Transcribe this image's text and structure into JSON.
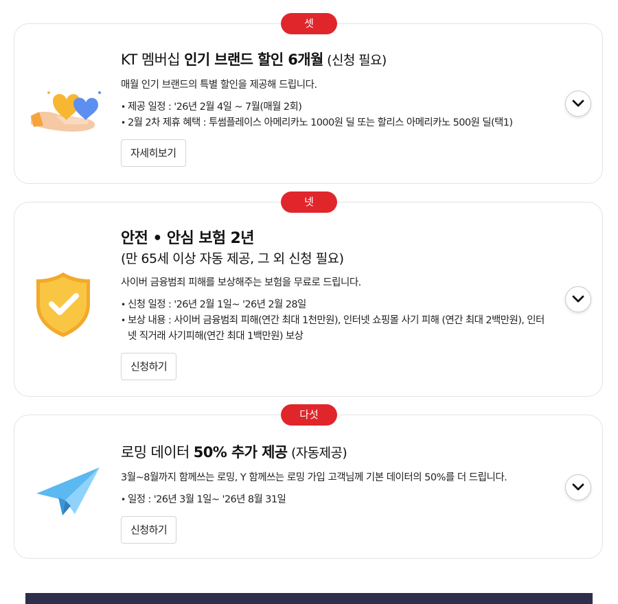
{
  "benefits": [
    {
      "badge": "셋",
      "title_pre": "KT 멤버십 ",
      "title_bold": "인기 브랜드 할인 6개월",
      "title_post": " (신청 필요)",
      "description": "매월 인기 브랜드의 특별 할인을 제공해 드립니다.",
      "bullets": [
        "제공 일정 : '26년 2월 4일 ~ 7월(매월 2회)",
        "2월 2차 제휴 혜택 : 투썸플레이스 아메리카노 1000원 딜 또는 할리스 아메리카노 500원 딜(택1)"
      ],
      "button_label": "자세히보기",
      "illustration": "hand-with-hearts-icon"
    },
    {
      "badge": "넷",
      "title_bold": "안전 • 안심 보험 2년",
      "title_sub": "(만 65세 이상 자동 제공, 그 외 신청 필요)",
      "description": "사이버 금융범죄 피해를 보상해주는 보험을 무료로 드립니다.",
      "bullets": [
        "신청 일정 : '26년 2월 1일~ '26년 2월 28일",
        "보상 내용 : 사이버 금융범죄 피해(연간 최대 1천만원), 인터넷 쇼핑몰 사기 피해 (연간 최대 2백만원), 인터넷 직거래 사기피해(연간 최대 1백만원) 보상"
      ],
      "button_label": "신청하기",
      "illustration": "shield-check-icon"
    },
    {
      "badge": "다섯",
      "title_pre": "로밍 데이터 ",
      "title_bold": "50% 추가 제공",
      "title_post": " (자동제공)",
      "description": "3월~8월까지 함께쓰는 로밍, Y 함께쓰는 로밍 가입 고객님께 기본 데이터의 50%를 더 드립니다.",
      "bullets": [
        "일정 : '26년 3월 1일~ '26년 8월 31일"
      ],
      "button_label": "신청하기",
      "illustration": "paper-plane-icon"
    }
  ],
  "colors": {
    "badge": "#e0262b",
    "card_border": "#e3e3e3",
    "banner": "#2e2f4a"
  }
}
